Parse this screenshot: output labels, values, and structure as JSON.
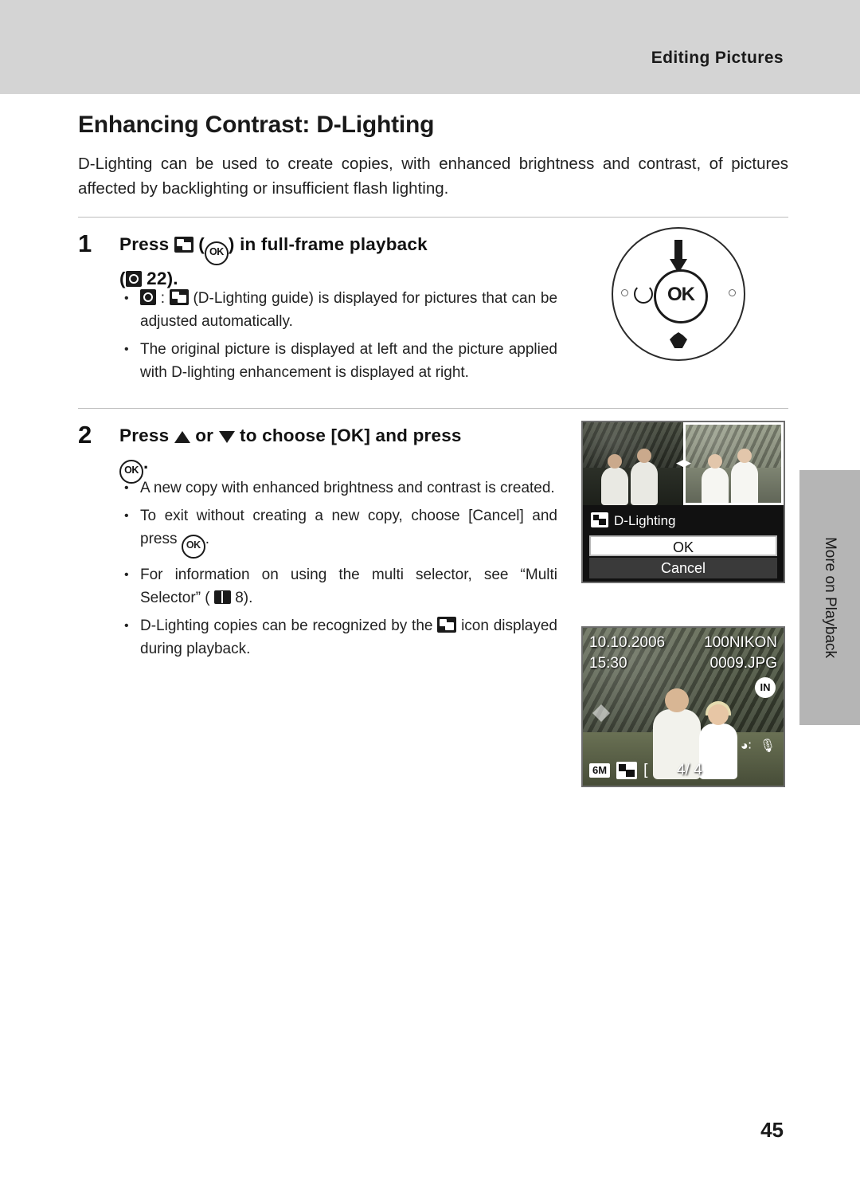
{
  "header": {
    "section_title": "Editing Pictures"
  },
  "page": {
    "title": "Enhancing Contrast: D-Lighting",
    "intro": "D-Lighting can be used to create copies, with enhanced brightness and contrast, of pictures affected by backlighting or insufficient flash lighting.",
    "number": "45"
  },
  "steps": [
    {
      "number": "1",
      "heading_pre": "Press",
      "heading_mid": "(",
      "heading_post": ") in full-frame playback",
      "heading_ref_open": "(",
      "heading_ref": "22).",
      "bullets": [
        ": (D-Lighting guide) is displayed for pictures that can be adjusted automatically.",
        "The original picture is displayed at left and the picture applied with D-lighting enhancement is displayed at right."
      ]
    },
    {
      "number": "2",
      "heading_pre": "Press",
      "heading_or": "or",
      "heading_post": "to choose [OK] and press",
      "heading_end": ".",
      "bullets": [
        "A new copy with enhanced brightness and contrast is created.",
        "To exit without creating a new copy, choose [Cancel] and press",
        "For information on using the multi selector, see “Multi Selector” (",
        "D-Lighting copies can be recognized by the"
      ],
      "bullet2_tail": ".",
      "bullet3_tail": "8).",
      "bullet4_tail": "icon displayed during playback."
    }
  ],
  "multi_selector": {
    "center_label": "OK",
    "icons": [
      "arrow-down",
      "self-timer",
      "macro",
      "ok-button"
    ]
  },
  "lcd_confirm": {
    "label": "D-Lighting",
    "ok_label": "OK",
    "cancel_label": "Cancel"
  },
  "lcd_playback": {
    "date": "10.10.2006",
    "time": "15:30",
    "folder": "100NIKON",
    "filename": "0009.JPG",
    "memory_badge": "IN",
    "image_size": "6M",
    "frame_counter": "4/   4",
    "bracket_left": "[",
    "volume_icon": "speaker-icon",
    "mic_icon": "microphone-icon"
  },
  "side_tab": {
    "label": "More on Playback"
  }
}
